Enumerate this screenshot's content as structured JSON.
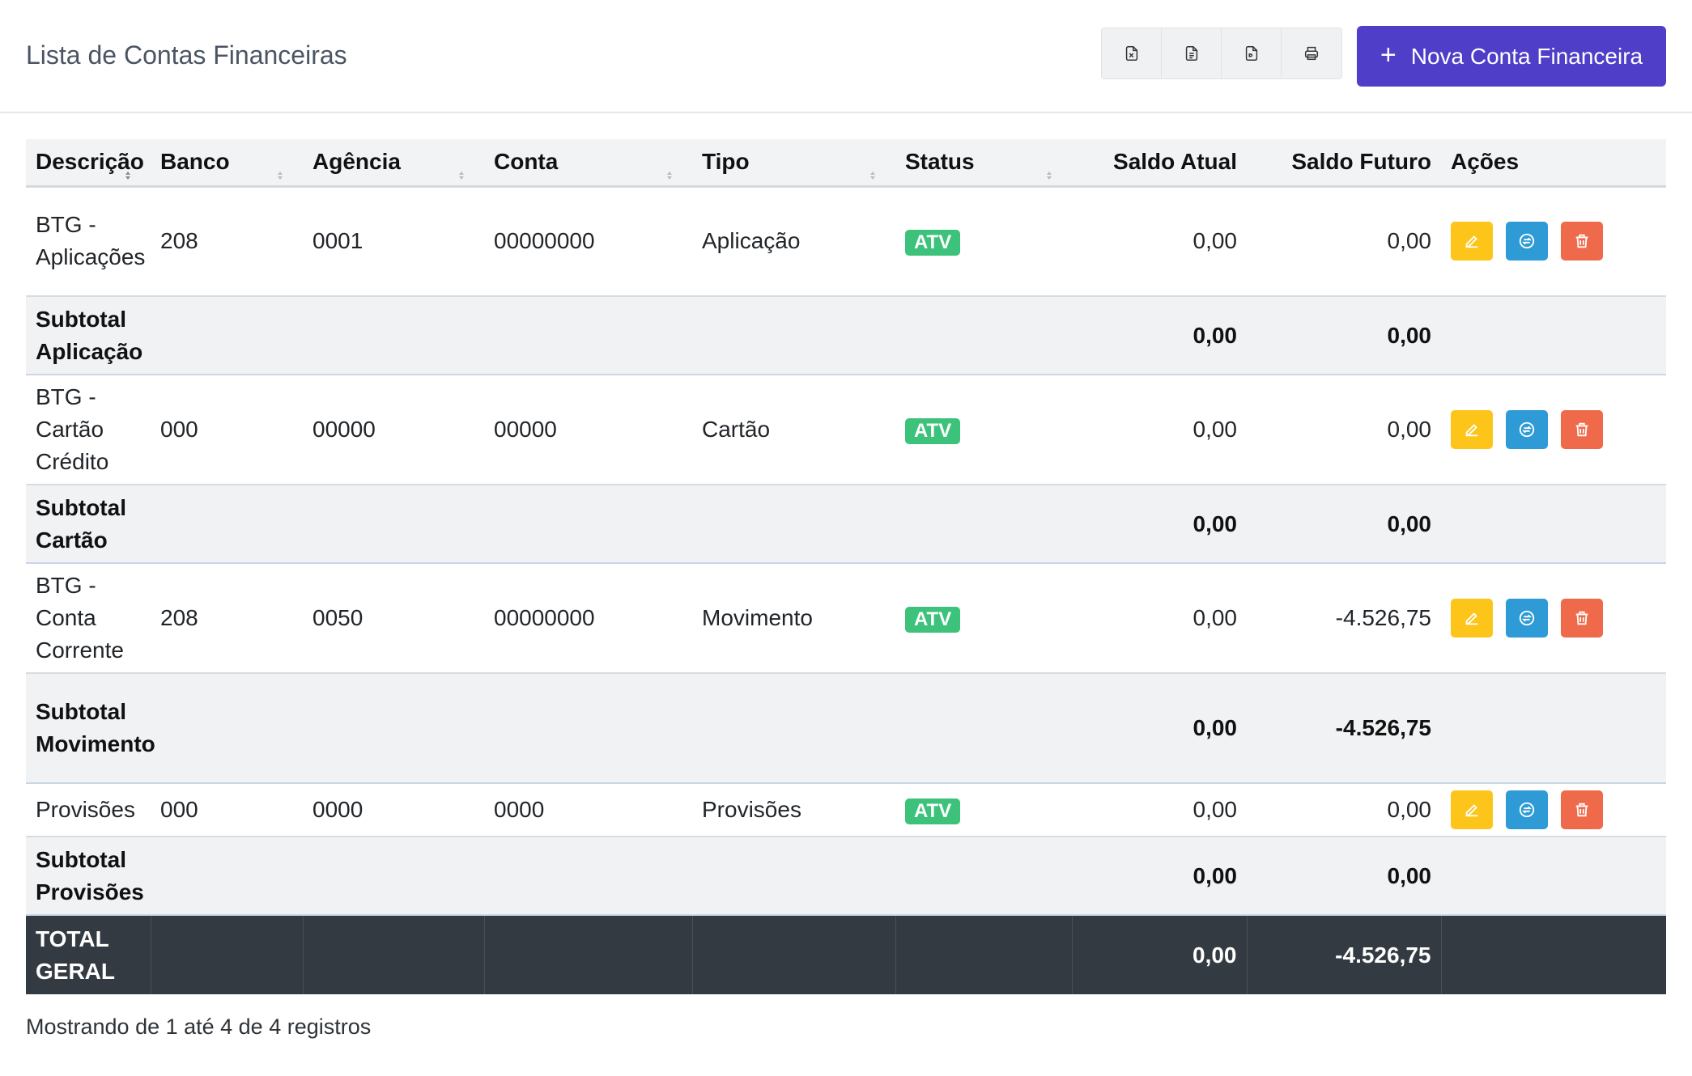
{
  "header": {
    "title": "Lista de Contas Financeiras",
    "new_button_label": "Nova Conta Financeira",
    "export_buttons": [
      "excel-icon",
      "csv-icon",
      "pdf-icon",
      "print-icon"
    ]
  },
  "table": {
    "columns": [
      "Descrição",
      "Banco",
      "Agência",
      "Conta",
      "Tipo",
      "Status",
      "Saldo Atual",
      "Saldo Futuro",
      "Ações"
    ],
    "rows": [
      {
        "descricao": "BTG - Aplicações",
        "banco": "208",
        "agencia": "0001",
        "conta": "00000000",
        "tipo": "Aplicação",
        "status": "ATV",
        "saldo_atual": "0,00",
        "saldo_futuro": "0,00"
      },
      {
        "descricao": "BTG - Cartão Crédito",
        "banco": "000",
        "agencia": "00000",
        "conta": "00000",
        "tipo": "Cartão",
        "status": "ATV",
        "saldo_atual": "0,00",
        "saldo_futuro": "0,00"
      },
      {
        "descricao": "BTG - Conta Corrente",
        "banco": "208",
        "agencia": "0050",
        "conta": "00000000",
        "tipo": "Movimento",
        "status": "ATV",
        "saldo_atual": "0,00",
        "saldo_futuro": "-4.526,75"
      },
      {
        "descricao": "Provisões",
        "banco": "000",
        "agencia": "0000",
        "conta": "0000",
        "tipo": "Provisões",
        "status": "ATV",
        "saldo_atual": "0,00",
        "saldo_futuro": "0,00"
      }
    ],
    "subtotals": [
      {
        "label": "Subtotal Aplicação",
        "saldo_atual": "0,00",
        "saldo_futuro": "0,00"
      },
      {
        "label": "Subtotal Cartão",
        "saldo_atual": "0,00",
        "saldo_futuro": "0,00"
      },
      {
        "label": "Subtotal Movimento",
        "saldo_atual": "0,00",
        "saldo_futuro": "-4.526,75"
      },
      {
        "label": "Subtotal Provisões",
        "saldo_atual": "0,00",
        "saldo_futuro": "0,00"
      }
    ],
    "total": {
      "label": "TOTAL GERAL",
      "saldo_atual": "0,00",
      "saldo_futuro": "-4.526,75"
    }
  },
  "footer": {
    "info": "Mostrando de 1 até 4 de 4 registros"
  },
  "colors": {
    "primary": "#4f3ec7",
    "status_active": "#3cc27a",
    "edit": "#fdc51a",
    "move": "#2e9bd6",
    "delete": "#ef6a4a",
    "total_bg": "#343a42"
  }
}
